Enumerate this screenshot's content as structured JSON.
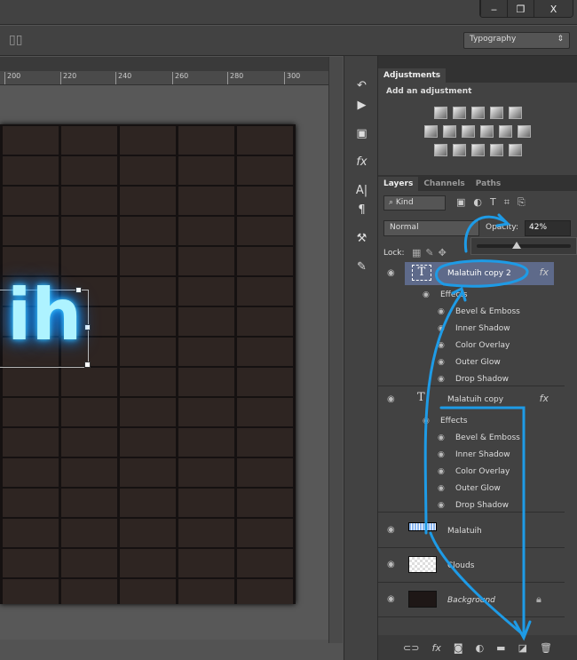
{
  "window": {
    "minimize": "‒",
    "restore": "❐",
    "close": "X"
  },
  "options": {
    "workspace": "Typography"
  },
  "ruler": {
    "ticks": [
      "200",
      "220",
      "240",
      "260",
      "280",
      "300"
    ]
  },
  "canvas": {
    "text": "ih"
  },
  "adjustments": {
    "tab": "Adjustments",
    "heading": "Add an adjustment"
  },
  "layers_panel": {
    "tabs": [
      "Layers",
      "Channels",
      "Paths"
    ],
    "filter": "Kind",
    "blend_mode": "Normal",
    "opacity_label": "Opacity:",
    "opacity": "42%",
    "opacity_value": 42,
    "lock_label": "Lock:",
    "effects_label": "Effects",
    "effects": [
      "Bevel & Emboss",
      "Inner Shadow",
      "Color Overlay",
      "Outer Glow",
      "Drop Shadow"
    ],
    "layers": [
      {
        "name": "Malatuih copy 2",
        "selected": true
      },
      {
        "name": "Malatuih copy"
      },
      {
        "name": "Malatuih"
      },
      {
        "name": "Clouds"
      },
      {
        "name": "Background"
      }
    ],
    "fx": "fx"
  },
  "colors": {
    "annotation": "#1e9be6",
    "selection": "#5e6a8a"
  }
}
